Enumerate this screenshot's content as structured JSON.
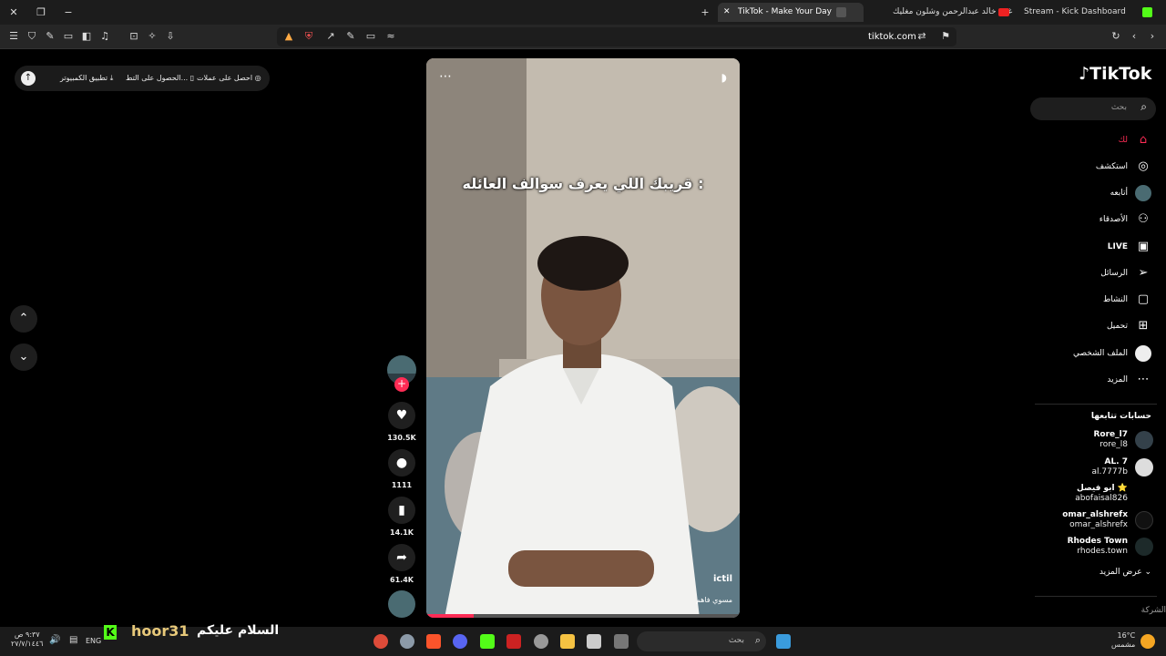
{
  "browser": {
    "tabs": [
      {
        "label": "Stream - Kick Dashboard"
      },
      {
        "label": "اغنية خالد عبدالرحمن وشلون مغليك - ..."
      },
      {
        "label": "TikTok - Make Your Day"
      }
    ],
    "url": "tiktok.com"
  },
  "promo": {
    "coins": "احصل على عملات",
    "app": "الحصول على التط...",
    "desktop": "تطبيق الكمبيوتر"
  },
  "video": {
    "caption": "قريبك اللي يعرف سوالف العائله :",
    "username": "ictil",
    "sound": "مسوي فاهم"
  },
  "actions": {
    "likes": "130.5K",
    "comments": "1111",
    "saves": "14.1K",
    "shares": "61.4K"
  },
  "sidebar": {
    "logo": "TikTok",
    "search_placeholder": "بحث",
    "nav": [
      {
        "label": "لك",
        "icon": "home-icon"
      },
      {
        "label": "استكشف",
        "icon": "compass-icon"
      },
      {
        "label": "أتابعه",
        "icon": "avatar-icon"
      },
      {
        "label": "الأصدقاء",
        "icon": "friends-icon"
      },
      {
        "label": "LIVE",
        "icon": "live-icon"
      },
      {
        "label": "الرسائل",
        "icon": "send-icon"
      },
      {
        "label": "النشاط",
        "icon": "activity-icon"
      },
      {
        "label": "تحميل",
        "icon": "upload-icon"
      },
      {
        "label": "الملف الشخصي",
        "icon": "profile-icon"
      },
      {
        "label": "المزيد",
        "icon": "more-icon"
      }
    ],
    "following_title": "حسابات تتابعها",
    "following": [
      {
        "name": "Rore_l7",
        "handle": "rore_l8"
      },
      {
        "name": "AL. 7",
        "handle": "al.7777b"
      },
      {
        "name": "ابو فيصل ⭐",
        "handle": "abofaisal826"
      },
      {
        "name": "omar_alshrefx",
        "handle": "omar_alshrefx"
      },
      {
        "name": "Rhodes Town",
        "handle": "rhodes.town"
      }
    ],
    "see_more": "عرض المزيد",
    "company": "الشركة"
  },
  "taskbar": {
    "overlay_user": "hoor31",
    "overlay_msg": "السلام عليكم",
    "search": "بحث",
    "lang": "ENG",
    "time": "٩:٣٧ ص",
    "date": "٢٧/٧/١٤٤٦",
    "temp": "16°C",
    "weather": "مشمس"
  }
}
